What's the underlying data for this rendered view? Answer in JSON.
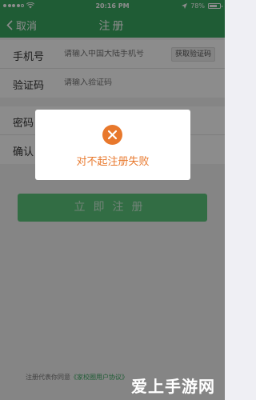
{
  "status_bar": {
    "carrier_dots": 5,
    "time": "20:16 PM",
    "battery": "78%"
  },
  "nav": {
    "back_label": "取消",
    "title": "注册"
  },
  "form": {
    "phone_label": "手机号",
    "phone_placeholder": "请输入中国大陆手机号",
    "get_code_label": "获取验证码",
    "code_label": "验证码",
    "code_placeholder": "请输入验证码",
    "password_label": "密码",
    "confirm_label": "确认"
  },
  "submit_label": "立即注册",
  "footer": {
    "terms_prefix": "注册代表你同意",
    "terms_link": "《家校圈用户协议》"
  },
  "watermark": "爱上手游网",
  "dialog": {
    "message": "对不起注册失败",
    "icon": "close-icon"
  },
  "colors": {
    "brand_green": "#3aa861",
    "error_orange": "#e8782c"
  }
}
